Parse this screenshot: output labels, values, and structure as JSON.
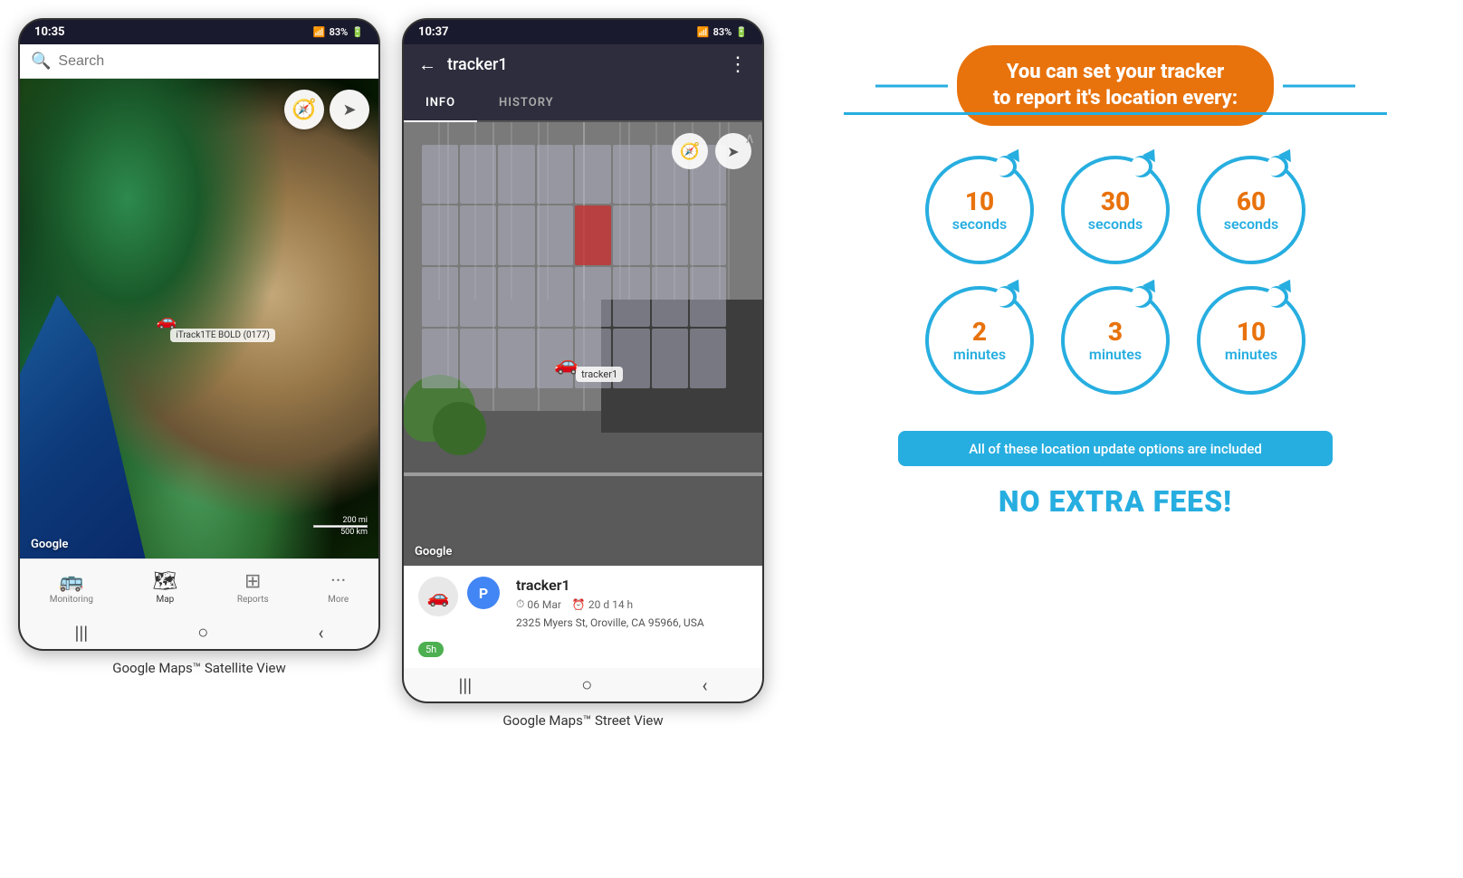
{
  "phone1": {
    "status_bar": {
      "time": "10:35",
      "signal": "▲▼",
      "wifi": "WiFi",
      "battery": "83%"
    },
    "search": {
      "placeholder": "Search"
    },
    "map": {
      "google_logo": "Google",
      "scale_mi": "200 mi",
      "scale_km": "500 km"
    },
    "tracker": {
      "label": "iTrack1TE BOLD (0177)"
    },
    "nav": {
      "items": [
        {
          "id": "monitoring",
          "label": "Monitoring",
          "icon": "🚌"
        },
        {
          "id": "map",
          "label": "Map",
          "icon": "🗺"
        },
        {
          "id": "reports",
          "label": "Reports",
          "icon": "⊞"
        },
        {
          "id": "more",
          "label": "More",
          "icon": "···"
        }
      ]
    },
    "caption": "Google Maps™ Satellite View"
  },
  "phone2": {
    "status_bar": {
      "time": "10:37",
      "battery": "83%"
    },
    "header": {
      "back": "←",
      "title": "tracker1",
      "more": "⋮"
    },
    "tabs": [
      {
        "label": "INFO",
        "active": true
      },
      {
        "label": "HISTORY",
        "active": false
      }
    ],
    "map": {
      "google_logo": "Google"
    },
    "tracker": {
      "name": "tracker1",
      "date": "06 Mar",
      "duration": "20 d 14 h",
      "address": "2325 Myers St, Oroville, CA 95966, USA",
      "status": "5h"
    },
    "caption": "Google Maps™ Street View"
  },
  "info_panel": {
    "header": "You can set your tracker\nto report it's location every:",
    "circles": [
      {
        "number": "10",
        "unit": "seconds"
      },
      {
        "number": "30",
        "unit": "seconds"
      },
      {
        "number": "60",
        "unit": "seconds"
      },
      {
        "number": "2",
        "unit": "minutes"
      },
      {
        "number": "3",
        "unit": "minutes"
      },
      {
        "number": "10",
        "unit": "minutes"
      }
    ],
    "banner_text": "All of these location update options are included",
    "no_fees": "NO EXTRA FEES!"
  }
}
